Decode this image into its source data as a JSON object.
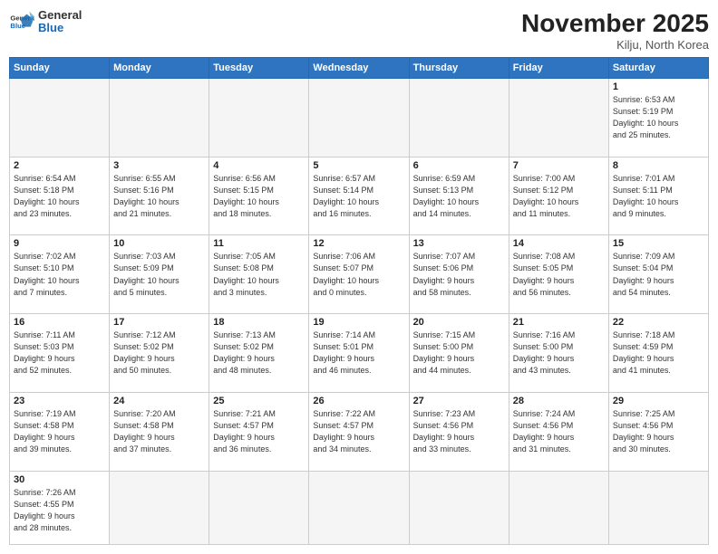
{
  "header": {
    "logo_general": "General",
    "logo_blue": "Blue",
    "month_title": "November 2025",
    "location": "Kilju, North Korea"
  },
  "days_of_week": [
    "Sunday",
    "Monday",
    "Tuesday",
    "Wednesday",
    "Thursday",
    "Friday",
    "Saturday"
  ],
  "weeks": [
    [
      {
        "day": "",
        "info": ""
      },
      {
        "day": "",
        "info": ""
      },
      {
        "day": "",
        "info": ""
      },
      {
        "day": "",
        "info": ""
      },
      {
        "day": "",
        "info": ""
      },
      {
        "day": "",
        "info": ""
      },
      {
        "day": "1",
        "info": "Sunrise: 6:53 AM\nSunset: 5:19 PM\nDaylight: 10 hours\nand 25 minutes."
      }
    ],
    [
      {
        "day": "2",
        "info": "Sunrise: 6:54 AM\nSunset: 5:18 PM\nDaylight: 10 hours\nand 23 minutes."
      },
      {
        "day": "3",
        "info": "Sunrise: 6:55 AM\nSunset: 5:16 PM\nDaylight: 10 hours\nand 21 minutes."
      },
      {
        "day": "4",
        "info": "Sunrise: 6:56 AM\nSunset: 5:15 PM\nDaylight: 10 hours\nand 18 minutes."
      },
      {
        "day": "5",
        "info": "Sunrise: 6:57 AM\nSunset: 5:14 PM\nDaylight: 10 hours\nand 16 minutes."
      },
      {
        "day": "6",
        "info": "Sunrise: 6:59 AM\nSunset: 5:13 PM\nDaylight: 10 hours\nand 14 minutes."
      },
      {
        "day": "7",
        "info": "Sunrise: 7:00 AM\nSunset: 5:12 PM\nDaylight: 10 hours\nand 11 minutes."
      },
      {
        "day": "8",
        "info": "Sunrise: 7:01 AM\nSunset: 5:11 PM\nDaylight: 10 hours\nand 9 minutes."
      }
    ],
    [
      {
        "day": "9",
        "info": "Sunrise: 7:02 AM\nSunset: 5:10 PM\nDaylight: 10 hours\nand 7 minutes."
      },
      {
        "day": "10",
        "info": "Sunrise: 7:03 AM\nSunset: 5:09 PM\nDaylight: 10 hours\nand 5 minutes."
      },
      {
        "day": "11",
        "info": "Sunrise: 7:05 AM\nSunset: 5:08 PM\nDaylight: 10 hours\nand 3 minutes."
      },
      {
        "day": "12",
        "info": "Sunrise: 7:06 AM\nSunset: 5:07 PM\nDaylight: 10 hours\nand 0 minutes."
      },
      {
        "day": "13",
        "info": "Sunrise: 7:07 AM\nSunset: 5:06 PM\nDaylight: 9 hours\nand 58 minutes."
      },
      {
        "day": "14",
        "info": "Sunrise: 7:08 AM\nSunset: 5:05 PM\nDaylight: 9 hours\nand 56 minutes."
      },
      {
        "day": "15",
        "info": "Sunrise: 7:09 AM\nSunset: 5:04 PM\nDaylight: 9 hours\nand 54 minutes."
      }
    ],
    [
      {
        "day": "16",
        "info": "Sunrise: 7:11 AM\nSunset: 5:03 PM\nDaylight: 9 hours\nand 52 minutes."
      },
      {
        "day": "17",
        "info": "Sunrise: 7:12 AM\nSunset: 5:02 PM\nDaylight: 9 hours\nand 50 minutes."
      },
      {
        "day": "18",
        "info": "Sunrise: 7:13 AM\nSunset: 5:02 PM\nDaylight: 9 hours\nand 48 minutes."
      },
      {
        "day": "19",
        "info": "Sunrise: 7:14 AM\nSunset: 5:01 PM\nDaylight: 9 hours\nand 46 minutes."
      },
      {
        "day": "20",
        "info": "Sunrise: 7:15 AM\nSunset: 5:00 PM\nDaylight: 9 hours\nand 44 minutes."
      },
      {
        "day": "21",
        "info": "Sunrise: 7:16 AM\nSunset: 5:00 PM\nDaylight: 9 hours\nand 43 minutes."
      },
      {
        "day": "22",
        "info": "Sunrise: 7:18 AM\nSunset: 4:59 PM\nDaylight: 9 hours\nand 41 minutes."
      }
    ],
    [
      {
        "day": "23",
        "info": "Sunrise: 7:19 AM\nSunset: 4:58 PM\nDaylight: 9 hours\nand 39 minutes."
      },
      {
        "day": "24",
        "info": "Sunrise: 7:20 AM\nSunset: 4:58 PM\nDaylight: 9 hours\nand 37 minutes."
      },
      {
        "day": "25",
        "info": "Sunrise: 7:21 AM\nSunset: 4:57 PM\nDaylight: 9 hours\nand 36 minutes."
      },
      {
        "day": "26",
        "info": "Sunrise: 7:22 AM\nSunset: 4:57 PM\nDaylight: 9 hours\nand 34 minutes."
      },
      {
        "day": "27",
        "info": "Sunrise: 7:23 AM\nSunset: 4:56 PM\nDaylight: 9 hours\nand 33 minutes."
      },
      {
        "day": "28",
        "info": "Sunrise: 7:24 AM\nSunset: 4:56 PM\nDaylight: 9 hours\nand 31 minutes."
      },
      {
        "day": "29",
        "info": "Sunrise: 7:25 AM\nSunset: 4:56 PM\nDaylight: 9 hours\nand 30 minutes."
      }
    ],
    [
      {
        "day": "30",
        "info": "Sunrise: 7:26 AM\nSunset: 4:55 PM\nDaylight: 9 hours\nand 28 minutes."
      },
      {
        "day": "",
        "info": ""
      },
      {
        "day": "",
        "info": ""
      },
      {
        "day": "",
        "info": ""
      },
      {
        "day": "",
        "info": ""
      },
      {
        "day": "",
        "info": ""
      },
      {
        "day": "",
        "info": ""
      }
    ]
  ]
}
